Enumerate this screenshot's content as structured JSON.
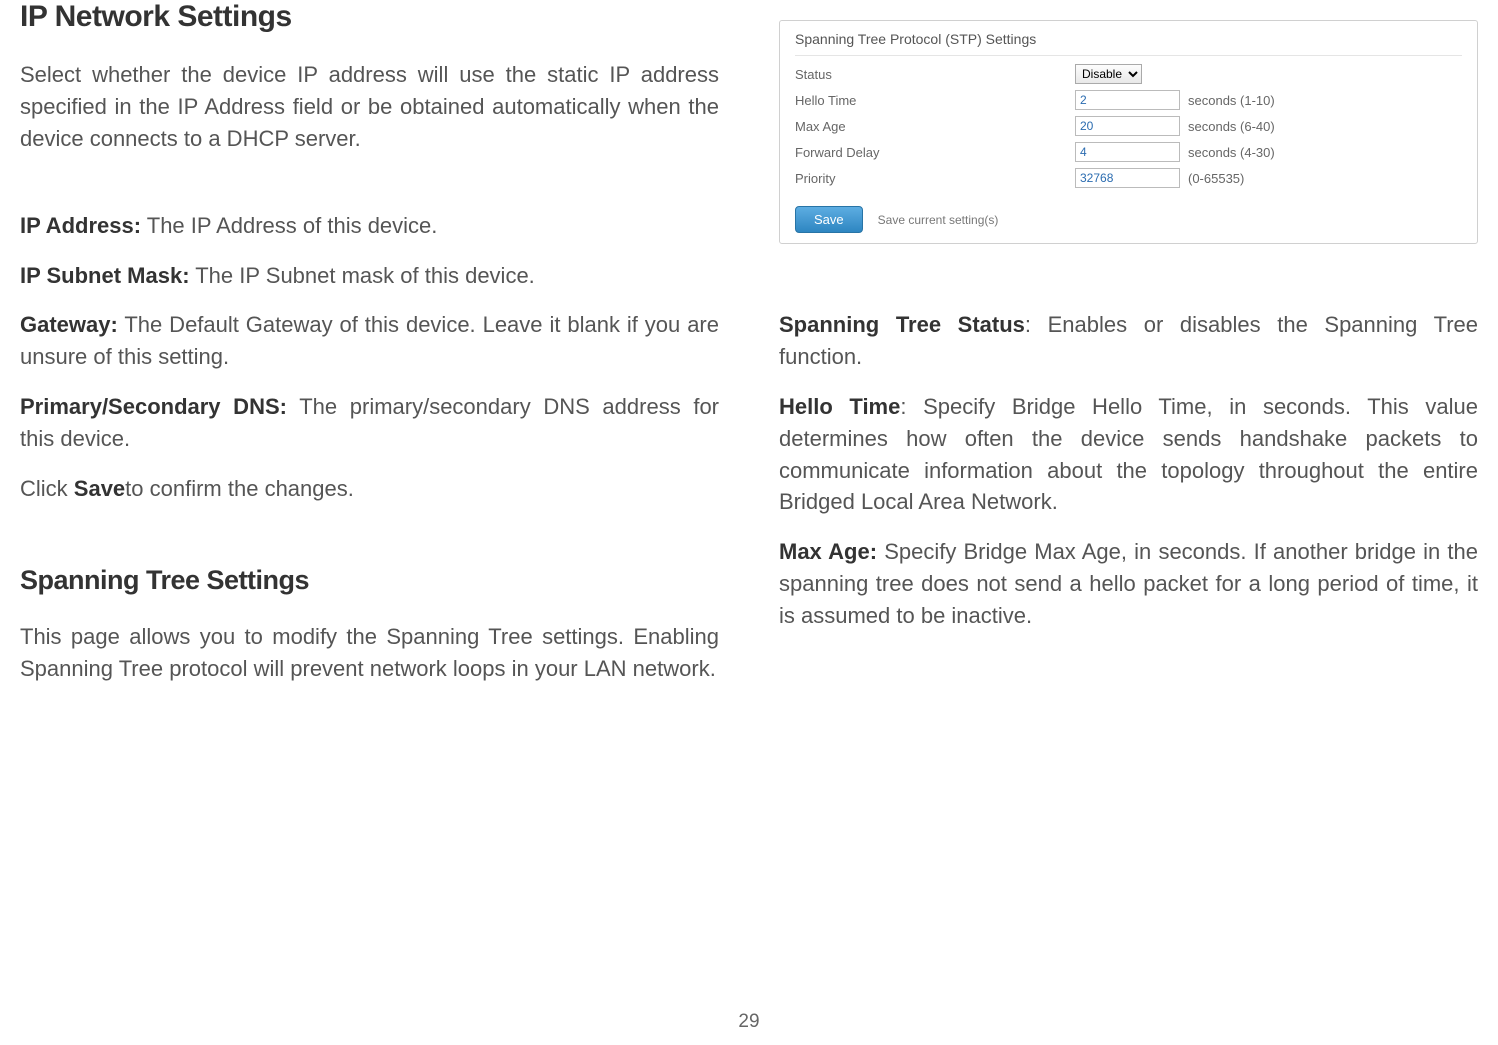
{
  "leftColumn": {
    "heading1": "IP Network Settings",
    "intro1": "Select whether the device IP address will use the static IP address specified in the IP Address field or be obtained automatically when the device connects to a DHCP server.",
    "ipAddressLabel": "IP Address:",
    "ipAddressText": " The IP Address of this device.",
    "subnetMaskLabel": "IP Subnet Mask:",
    "subnetMaskText": " The IP Subnet mask of this device.",
    "gatewayLabel": "Gateway:",
    "gatewayText": " The Default Gateway of this device. Leave it blank if you are unsure of this setting.",
    "dnsLabel": "Primary/Secondary DNS:",
    "dnsText": " The primary/secondary DNS address for this device.",
    "savePrefix": "Click ",
    "saveLabel": "Save",
    "saveSuffix": "to confirm the changes.",
    "heading2": "Spanning Tree Settings",
    "intro2": "This page allows you to modify the Spanning Tree settings. Enabling Spanning Tree protocol will prevent network loops in your LAN network."
  },
  "settingsBox": {
    "title": "Spanning Tree Protocol (STP) Settings",
    "rows": {
      "status": {
        "label": "Status",
        "value": "Disable"
      },
      "helloTime": {
        "label": "Hello Time",
        "value": "2",
        "hint": "seconds (1-10)"
      },
      "maxAge": {
        "label": "Max Age",
        "value": "20",
        "hint": "seconds (6-40)"
      },
      "forwardDelay": {
        "label": "Forward Delay",
        "value": "4",
        "hint": "seconds (4-30)"
      },
      "priority": {
        "label": "Priority",
        "value": "32768",
        "hint": "(0-65535)"
      }
    },
    "saveButton": "Save",
    "saveHint": "Save current setting(s)"
  },
  "rightColumn": {
    "stpStatusLabel": "Spanning Tree Status",
    "stpStatusText": ": Enables or disables the Spanning Tree function.",
    "helloTimeLabel": "Hello Time",
    "helloTimeText": ": Specify Bridge Hello Time, in seconds. This value determines how often the device sends handshake packets to communicate information about the topology throughout the entire Bridged Local Area Network.",
    "maxAgeLabel": "Max Age:",
    "maxAgeText": " Specify Bridge Max Age, in seconds. If another bridge in the spanning tree does not send a hello packet for a long period of time, it is assumed to be inactive."
  },
  "pageNumber": "29"
}
